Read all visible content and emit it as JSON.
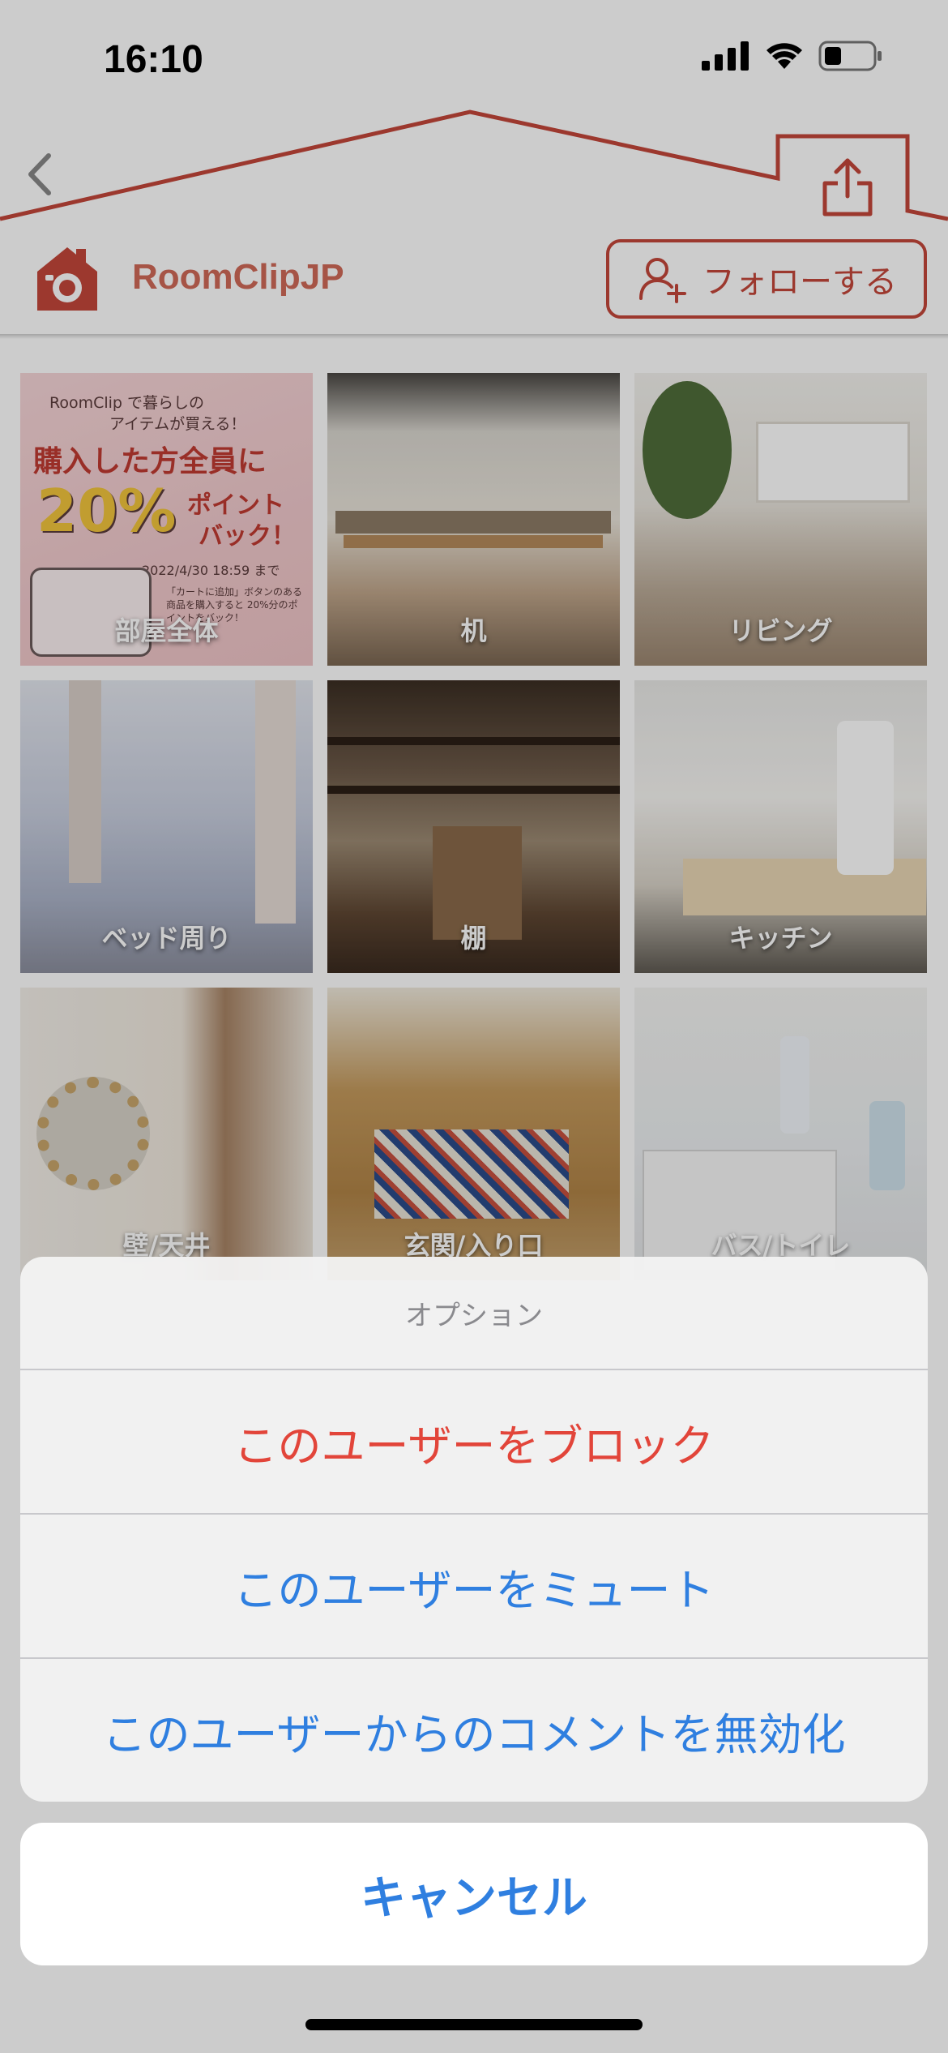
{
  "status_bar": {
    "time": "16:10"
  },
  "header": {
    "username": "RoomClipJP",
    "follow_label": "フォローする"
  },
  "tiles": [
    {
      "label": "部屋全体"
    },
    {
      "label": "机"
    },
    {
      "label": "リビング"
    },
    {
      "label": "ベッド周り"
    },
    {
      "label": "棚"
    },
    {
      "label": "キッチン"
    },
    {
      "label": "壁/天井"
    },
    {
      "label": "玄関/入り口"
    },
    {
      "label": "バス/トイレ"
    }
  ],
  "promo": {
    "line1": "RoomClip で暮らしの",
    "line2": "アイテムが買える！",
    "line3": "購入した方全員に",
    "percent": "20%",
    "bonus": "ポイント",
    "bonus2": "バック！",
    "date": "2022/4/30 18:59 まで",
    "note": "「カートに追加」ボタンのある商品を購入すると 20%分のポイントをバック！"
  },
  "action_sheet": {
    "title": "オプション",
    "block": "このユーザーをブロック",
    "mute": "このユーザーをミュート",
    "disable_comments": "このユーザーからのコメントを無効化",
    "cancel": "キャンセル"
  },
  "colors": {
    "brand": "#c4473a",
    "destructive": "#e2453a",
    "action": "#2f7fe0"
  }
}
